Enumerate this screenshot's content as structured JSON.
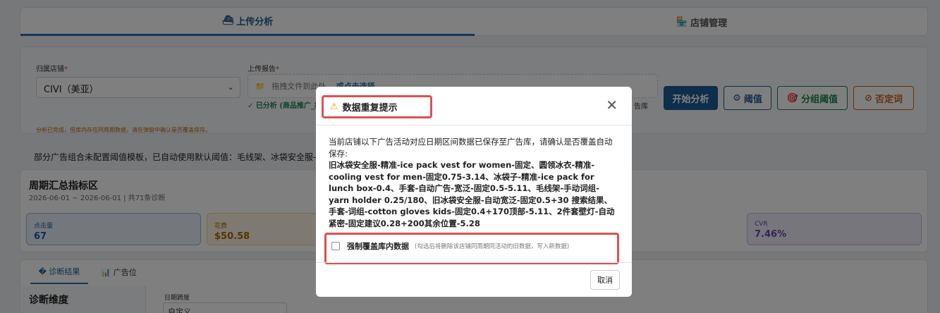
{
  "tabs": {
    "upload": {
      "icon": "⛴",
      "label": "上传分析"
    },
    "store": {
      "icon": "🏪",
      "label": "店铺管理"
    }
  },
  "upload_card": {
    "store_label": "归属店铺",
    "store_value": "CIVI（美亚）",
    "report_label": "上传报告",
    "dropzone_text": "拖拽文件到此处，",
    "dropzone_link": "或点击选择",
    "status_text": "✓ 已分析 (商品推广_搜",
    "status_tail": "告库",
    "warning": "分析已完成，但库内存在同周期数据，请在弹窗中确认是否覆盖保存。",
    "buttons": {
      "start": "开始分析",
      "threshold": "阈值",
      "group_threshold": "分组阈值",
      "negative": "否定词"
    }
  },
  "notice": "部分广告组合未配置阈值模板，已自动使用默认阈值：毛线架、冰袋安全服-老",
  "summary": {
    "title": "周期汇总指标区",
    "subtitle": "2026-06-01 ~ 2026-06-01 | 共71条诊断",
    "metrics": {
      "clicks": {
        "label": "点击量",
        "value": "67"
      },
      "spend": {
        "label": "花费",
        "value": "$50.58"
      },
      "cvr": {
        "label": "CVR",
        "value": "7.46%"
      }
    }
  },
  "results": {
    "tab_diag": "� 诊断结果",
    "tab_ads": "广告位",
    "dimension_title": "诊断维度",
    "date_label": "日期跨度",
    "date_value": "自定义"
  },
  "modal": {
    "title": "数据重复提示",
    "intro": "当前店铺以下广告活动对应日期区间数据已保存至广告库，请确认是否覆盖自动保存:",
    "campaigns": "旧冰袋安全服-精准-ice pack vest for women-固定、圆领冰衣-精准-cooling vest for men-固定0.75-3.14、冰袋子-精准-ice pack for lunch box-0.4、手套-自动广告-宽泛-固定0.5-5.11、毛线架-手动词组-yarn holder 0.25/180、旧冰袋安全服-自动宽泛-固定0.5+30 搜索结果、手套-词组-cotton gloves kids-固定0.4+170顶部-5.11、2件套壁灯-自动紧密-固定建议0.28+200其余位置-5.28",
    "force_label": "强制覆盖库内数据",
    "force_hint": "(勾选后将删除该店铺同周期同活动的旧数据，写入新数据)",
    "cancel": "取消"
  }
}
